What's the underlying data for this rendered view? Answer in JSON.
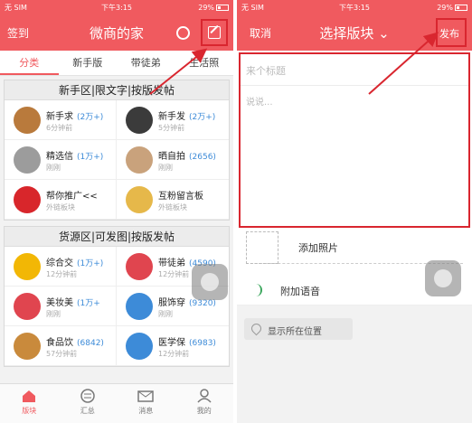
{
  "left": {
    "status": {
      "carrier": "无 SIM",
      "time": "下午3:15",
      "battery": "29%"
    },
    "nav": {
      "left_label": "签到",
      "title": "微商的家"
    },
    "tabs": [
      {
        "label": "分类",
        "active": true
      },
      {
        "label": "新手版",
        "active": false
      },
      {
        "label": "带徒弟",
        "active": false
      },
      {
        "label": "生活照",
        "active": false
      }
    ],
    "sections": [
      {
        "title": "新手区|限文字|按版发帖",
        "boards": [
          {
            "name": "新手求",
            "count": "(2万+)",
            "time": "6分钟前",
            "avatar_color": "#b97a3c"
          },
          {
            "name": "新手发",
            "count": "(2万+)",
            "time": "5分钟前",
            "avatar_color": "#3b3b3b"
          },
          {
            "name": "精选信",
            "count": "(1万+)",
            "time": "刚刚",
            "avatar_color": "#9c9c9c"
          },
          {
            "name": "晒自拍",
            "count": "(2656)",
            "time": "刚刚",
            "avatar_color": "#c9a27c"
          },
          {
            "name": "帮你推广<<",
            "count": "",
            "time": "外链板块",
            "avatar_color": "#d8262b"
          },
          {
            "name": "互粉留言板",
            "count": "",
            "time": "外链板块",
            "avatar_color": "#e6b84a"
          }
        ]
      },
      {
        "title": "货源区|可发图|按版发帖",
        "boards": [
          {
            "name": "综合交",
            "count": "(1万+)",
            "time": "12分钟前",
            "avatar_color": "#f2b705"
          },
          {
            "name": "带徒弟",
            "count": "(4590)",
            "time": "12分钟前",
            "avatar_color": "#e0454f"
          },
          {
            "name": "美妆美",
            "count": "(1万+",
            "time": "刚刚",
            "avatar_color": "#e0454f"
          },
          {
            "name": "服饰穿",
            "count": "(9320)",
            "time": "刚刚",
            "avatar_color": "#3d8bd8"
          },
          {
            "name": "食品饮",
            "count": "(6842)",
            "time": "57分钟前",
            "avatar_color": "#c98a3c"
          },
          {
            "name": "医学保",
            "count": "(6983)",
            "time": "12分钟前",
            "avatar_color": "#3d8bd8"
          }
        ]
      }
    ],
    "tabbar": [
      {
        "label": "版块",
        "active": true
      },
      {
        "label": "汇总",
        "active": false
      },
      {
        "label": "消息",
        "active": false
      },
      {
        "label": "我的",
        "active": false
      }
    ]
  },
  "right": {
    "status": {
      "carrier": "无 SIM",
      "time": "下午3:15",
      "battery": "29%"
    },
    "nav": {
      "cancel_label": "取消",
      "title": "选择版块",
      "post_label": "发布"
    },
    "editor": {
      "title_placeholder": "来个标题",
      "body_placeholder": "说说..."
    },
    "add_photo_label": "添加照片",
    "add_voice_label": "附加语音",
    "location_label": "显示所在位置"
  },
  "colors": {
    "accent": "#f05a5f",
    "highlight": "#d9262f",
    "link": "#3d8bd8"
  }
}
